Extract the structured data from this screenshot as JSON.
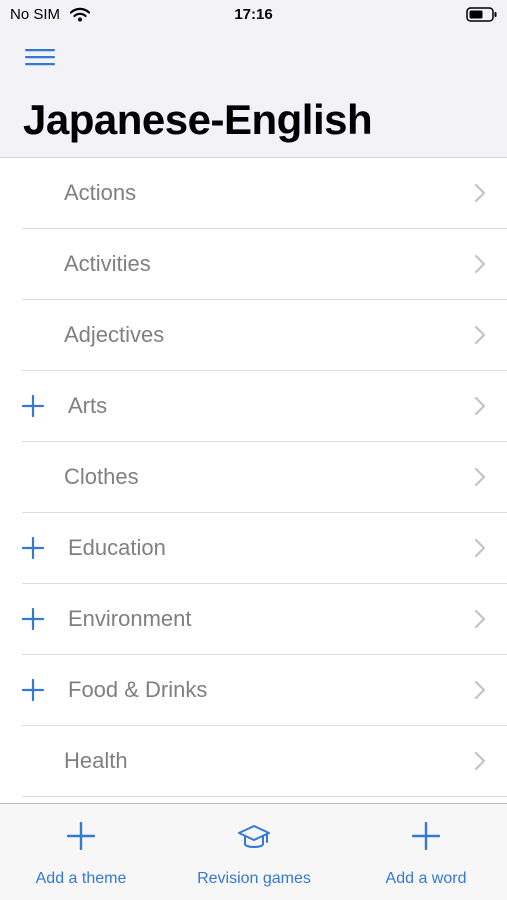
{
  "status_bar": {
    "carrier": "No SIM",
    "time": "17:16"
  },
  "header": {
    "title": "Japanese-English"
  },
  "themes": [
    {
      "label": "Actions",
      "has_add": false
    },
    {
      "label": "Activities",
      "has_add": false
    },
    {
      "label": "Adjectives",
      "has_add": false
    },
    {
      "label": "Arts",
      "has_add": true
    },
    {
      "label": "Clothes",
      "has_add": false
    },
    {
      "label": "Education",
      "has_add": true
    },
    {
      "label": "Environment",
      "has_add": true
    },
    {
      "label": "Food & Drinks",
      "has_add": true
    },
    {
      "label": "Health",
      "has_add": false
    }
  ],
  "tabbar": {
    "add_theme": "Add a theme",
    "revision_games": "Revision games",
    "add_word": "Add a word"
  },
  "colors": {
    "accent": "#3478d6",
    "label": "#7f7f84",
    "header_bg": "#f2f2f7"
  }
}
